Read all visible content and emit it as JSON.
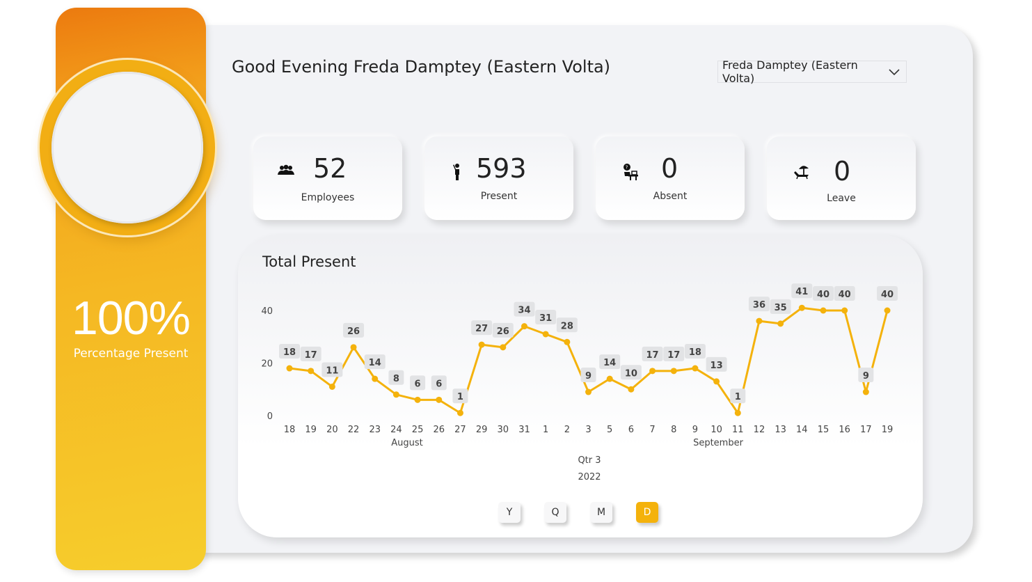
{
  "greeting": "Good Evening Freda Damptey (Eastern Volta)",
  "dropdown": {
    "selected": "Freda Damptey (Eastern Volta)"
  },
  "summary": {
    "percentage": "100%",
    "percentage_label": "Percentage Present"
  },
  "kpis": [
    {
      "value": "52",
      "label": "Employees",
      "icon": "team-icon"
    },
    {
      "value": "593",
      "label": "Present",
      "icon": "person-standing-icon"
    },
    {
      "value": "0",
      "label": "Absent",
      "icon": "absent-desk-icon"
    },
    {
      "value": "0",
      "label": "Leave",
      "icon": "beach-umbrella-icon"
    }
  ],
  "chart_title": "Total Present",
  "chart_data": {
    "type": "line",
    "title": "Total Present",
    "x": [
      "18",
      "19",
      "20",
      "22",
      "23",
      "24",
      "25",
      "26",
      "27",
      "29",
      "30",
      "31",
      "1",
      "2",
      "3",
      "5",
      "6",
      "7",
      "8",
      "9",
      "10",
      "11",
      "12",
      "13",
      "14",
      "15",
      "16",
      "17",
      "19"
    ],
    "values": [
      18,
      17,
      11,
      26,
      14,
      8,
      6,
      6,
      1,
      27,
      26,
      34,
      31,
      28,
      9,
      14,
      10,
      17,
      17,
      18,
      13,
      1,
      36,
      35,
      41,
      40,
      40,
      9,
      40
    ],
    "y_ticks": [
      "0",
      "20",
      "40"
    ],
    "ylim": [
      0,
      40
    ],
    "month_labels": [
      "August",
      "September"
    ],
    "quarter_label": "Qtr 3",
    "year_label": "2022",
    "line_color": "#f4b20c",
    "data_labels": true,
    "grid": false
  },
  "toggles": [
    {
      "label": "Y",
      "active": false
    },
    {
      "label": "Q",
      "active": false
    },
    {
      "label": "M",
      "active": false
    },
    {
      "label": "D",
      "active": true
    }
  ],
  "colors": {
    "accent": "#f4b20c",
    "panel_gradient_top": "#ec7a0f",
    "panel_gradient_bottom": "#f6cd2c"
  }
}
